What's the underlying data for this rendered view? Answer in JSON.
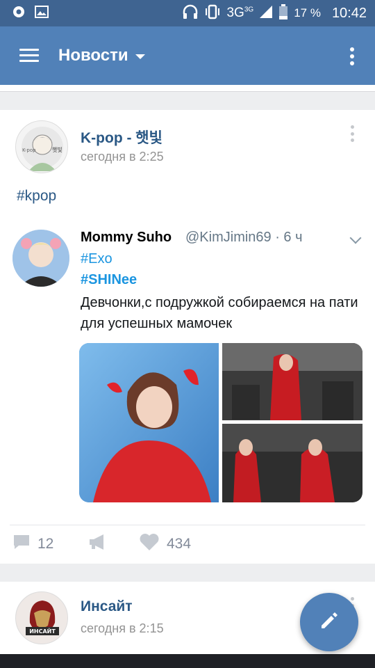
{
  "status_bar": {
    "network": "3G",
    "network_sup": "3G",
    "battery_percent": "17 %",
    "time": "10:42"
  },
  "app_bar": {
    "title": "Новости"
  },
  "post1": {
    "author": "K-pop - 햇빛",
    "time": "сегодня в 2:25",
    "hashtag": "#kpop",
    "avatar_text_left": "K-pop",
    "avatar_text_right": "햇빛",
    "tweet": {
      "name": "Mommy Suho",
      "handle": "@KimJimin69 · 6 ч",
      "tag1": "#Exo",
      "tag2": "#SHINee",
      "text": "Девчонки,с подружкой  собираемся на пати для успешных мамочек"
    },
    "actions": {
      "comments": "12",
      "likes": "434"
    }
  },
  "post2": {
    "author": "Инсайт",
    "time": "сегодня в 2:15",
    "avatar_text": "ИНСАЙТ"
  },
  "colors": {
    "status_bar": "#3f6491",
    "app_bar": "#5181b8",
    "link": "#2a5885",
    "twitter_blue": "#1b95e0"
  }
}
